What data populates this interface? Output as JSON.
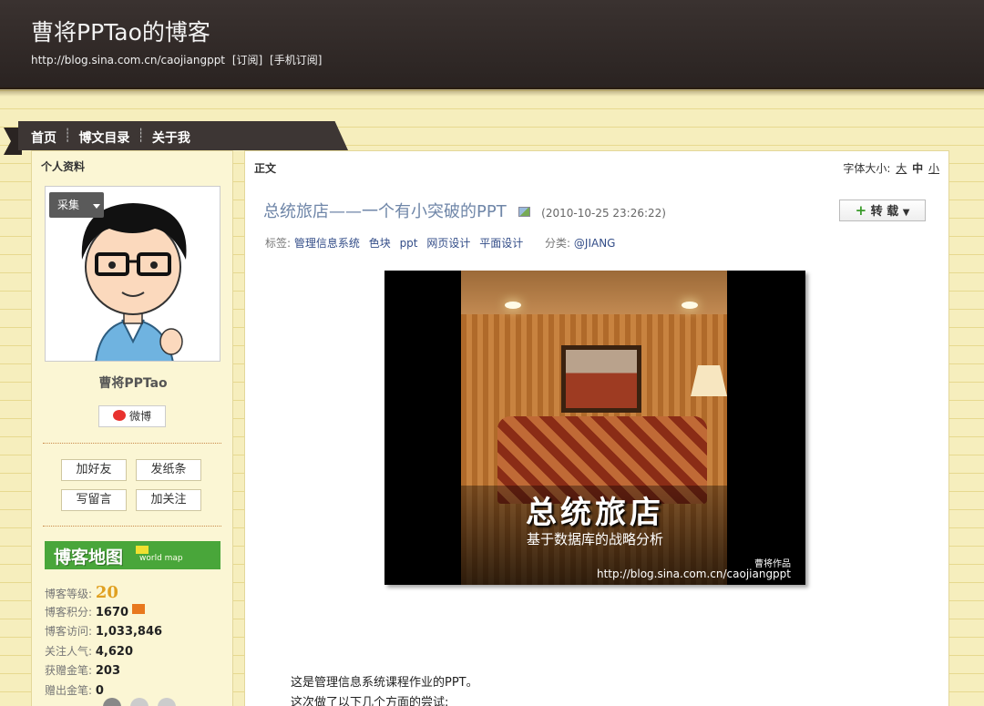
{
  "header": {
    "title": "曹将PPTao的博客",
    "url": "http://blog.sina.com.cn/caojiangppt",
    "subscribe": "[订阅]",
    "mobile_subscribe": "[手机订阅]"
  },
  "nav": {
    "items": [
      "首页",
      "博文目录",
      "关于我"
    ],
    "separator": "┊"
  },
  "sidebar": {
    "heading": "个人资料",
    "collect_label": "采集",
    "name": "曹将PPTao",
    "weibo_label": "微博",
    "buttons": {
      "add_friend": "加好友",
      "send_note": "发纸条",
      "leave_message": "写留言",
      "follow": "加关注"
    },
    "map_banner": {
      "text": "博客地图",
      "small": "world map"
    },
    "stats": [
      {
        "label": "博客等级:",
        "value": "20"
      },
      {
        "label": "博客积分:",
        "value": "1670"
      },
      {
        "label": "博客访问:",
        "value": "1,033,846"
      },
      {
        "label": "关注人气:",
        "value": "4,620"
      },
      {
        "label": "获赠金笔:",
        "value": "203"
      },
      {
        "label": "赠出金笔:",
        "value": "0"
      }
    ]
  },
  "main": {
    "heading": "正文",
    "font_size": {
      "label": "字体大小:",
      "large": "大",
      "medium": "中",
      "small": "小"
    },
    "post": {
      "title": "总统旅店——一个有小突破的PPT",
      "date": "(2010-10-25 23:26:22)",
      "repost_label": "转 载",
      "tags_label": "标签:",
      "tags": [
        "管理信息系统",
        "色块",
        "ppt",
        "网页设计",
        "平面设计"
      ],
      "category_label": "分类:",
      "category": "@JIANG",
      "image": {
        "title": "总统旅店",
        "subtitle": "基于数据库的战略分析",
        "author": "曹将作品",
        "url": "http://blog.sina.com.cn/caojiangppt"
      },
      "paragraphs": [
        "这是管理信息系统课程作业的PPT。",
        "这次做了以下几个方面的尝试:"
      ]
    }
  },
  "colors": {
    "header_bg": "#2a2321",
    "title_link": "#6f86a8",
    "tag_link": "#334d88",
    "map_green": "#49a63a"
  }
}
